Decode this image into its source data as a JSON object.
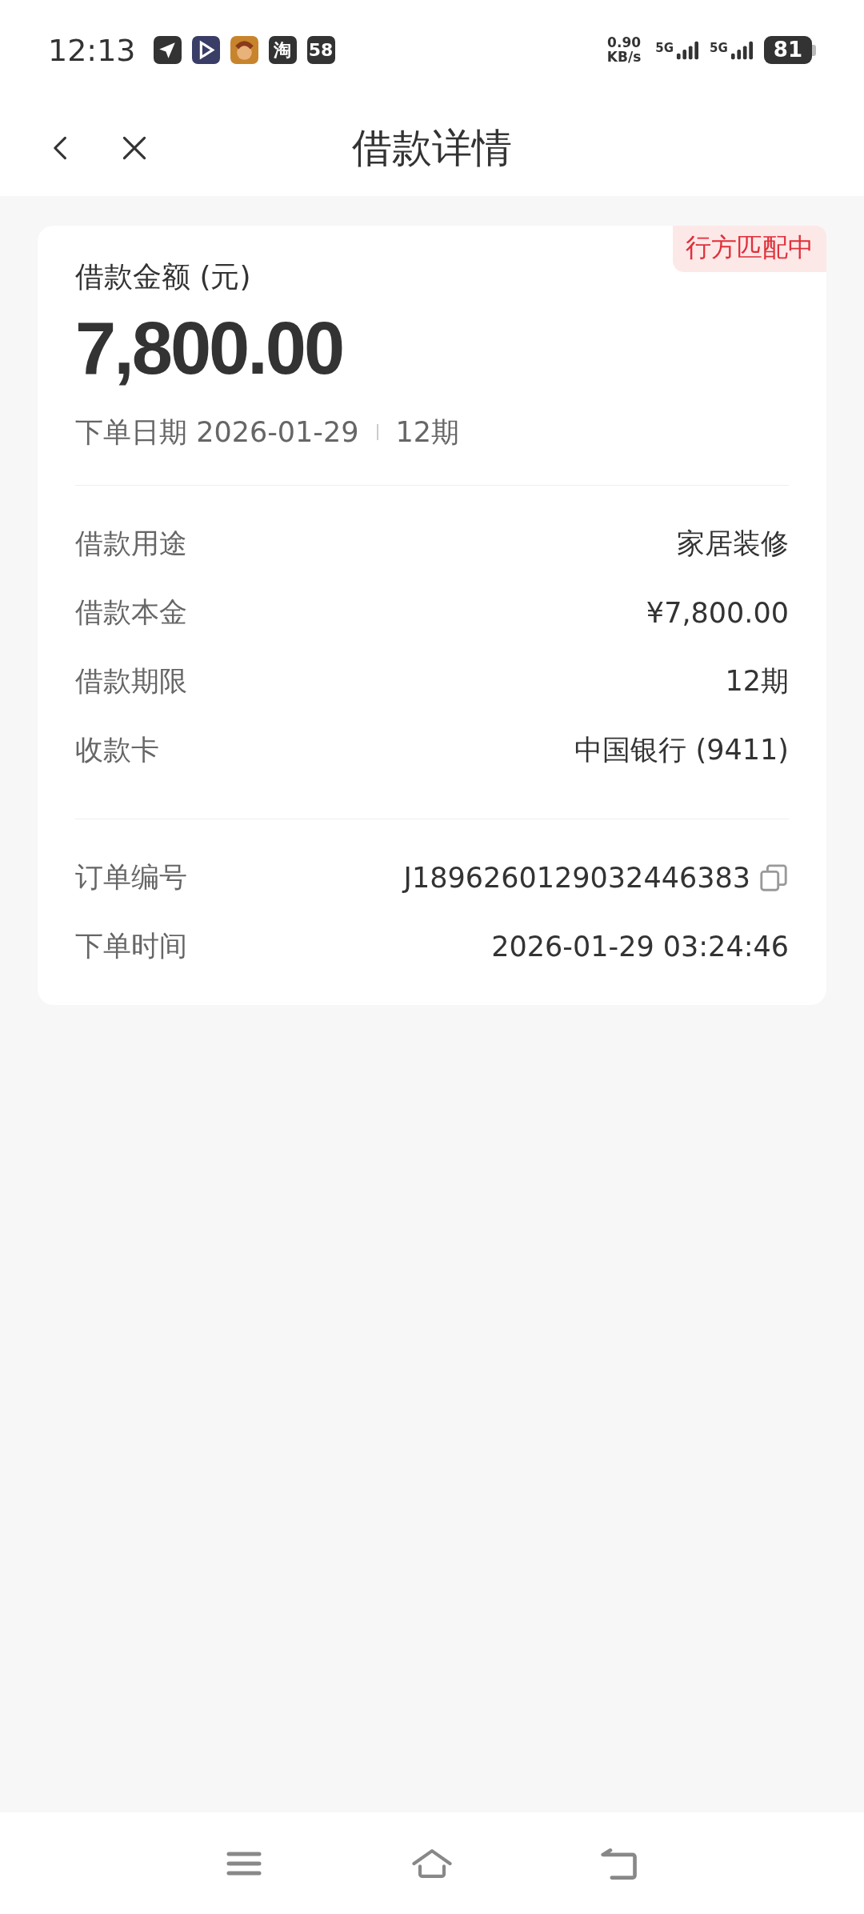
{
  "status_bar": {
    "time": "12:13",
    "app_icons": [
      {
        "kind": "plane"
      },
      {
        "kind": "play"
      },
      {
        "kind": "game"
      },
      {
        "kind": "text",
        "label": "淘"
      },
      {
        "kind": "text",
        "label": "58"
      }
    ],
    "speed_value": "0.90",
    "speed_unit": "KB/s",
    "signals": [
      "5G",
      "5G"
    ],
    "battery": "81"
  },
  "header": {
    "title": "借款详情"
  },
  "card": {
    "badge": "行方匹配中",
    "amount_label": "借款金额 (元)",
    "amount": "7,800.00",
    "date": "下单日期 2026-01-29",
    "term": "12期",
    "details": [
      {
        "label": "借款用途",
        "value": "家居装修"
      },
      {
        "label": "借款本金",
        "value": "¥7,800.00"
      },
      {
        "label": "借款期限",
        "value": "12期"
      },
      {
        "label": "收款卡",
        "value": "中国银行 (9411)"
      }
    ],
    "order": [
      {
        "label": "订单编号",
        "value": "J1896260129032446383",
        "kind": "copyable"
      },
      {
        "label": "下单时间",
        "value": "2026-01-29 03:24:46",
        "kind": "plain"
      }
    ]
  }
}
